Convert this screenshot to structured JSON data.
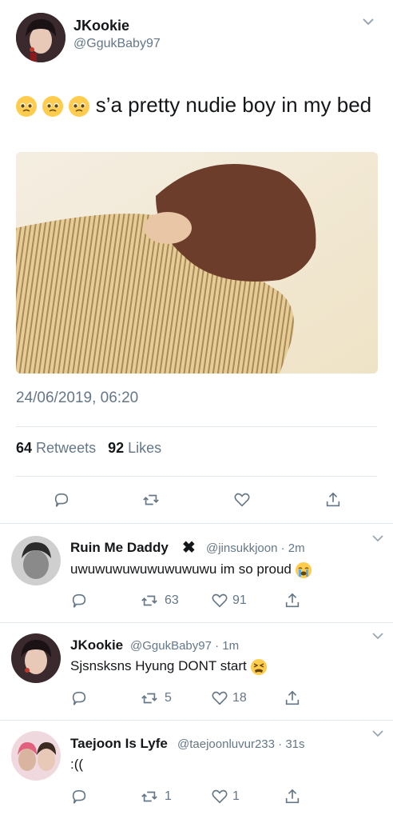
{
  "tweet": {
    "name": "JKookie",
    "handle": "@GgukBaby97",
    "text": "s’a pretty nudie boy in my bed",
    "emojis": [
      "pleading-face",
      "pleading-face",
      "pleading-face"
    ],
    "timestamp": "24/06/2019, 06:20",
    "retweets_count": "64",
    "retweets_label": "Retweets",
    "likes_count": "92",
    "likes_label": "Likes"
  },
  "replies": [
    {
      "name": "Ruin Me Daddy",
      "badge": "✖",
      "handle": "@jinsukkjoon",
      "time": "· 2m",
      "text": "uwuwuwuwuwuwuwuwu im so proud",
      "emoji": "loudly-crying-face",
      "retweets": "63",
      "likes": "91"
    },
    {
      "name": "JKookie",
      "handle": "@GgukBaby97",
      "time": "· 1m",
      "text": "Sjsnsksns Hyung DONT start",
      "emoji": "tired-face",
      "retweets": "5",
      "likes": "18"
    },
    {
      "name": "Taejoon Is Lyfe",
      "handle": "@taejoonluvur233",
      "time": "· 31s",
      "text": ":((",
      "retweets": "1",
      "likes": "1"
    }
  ],
  "colors": {
    "text": "#14171a",
    "secondary": "#657786",
    "divider": "#e1e8ed",
    "emoji": "#ffcc4d"
  }
}
